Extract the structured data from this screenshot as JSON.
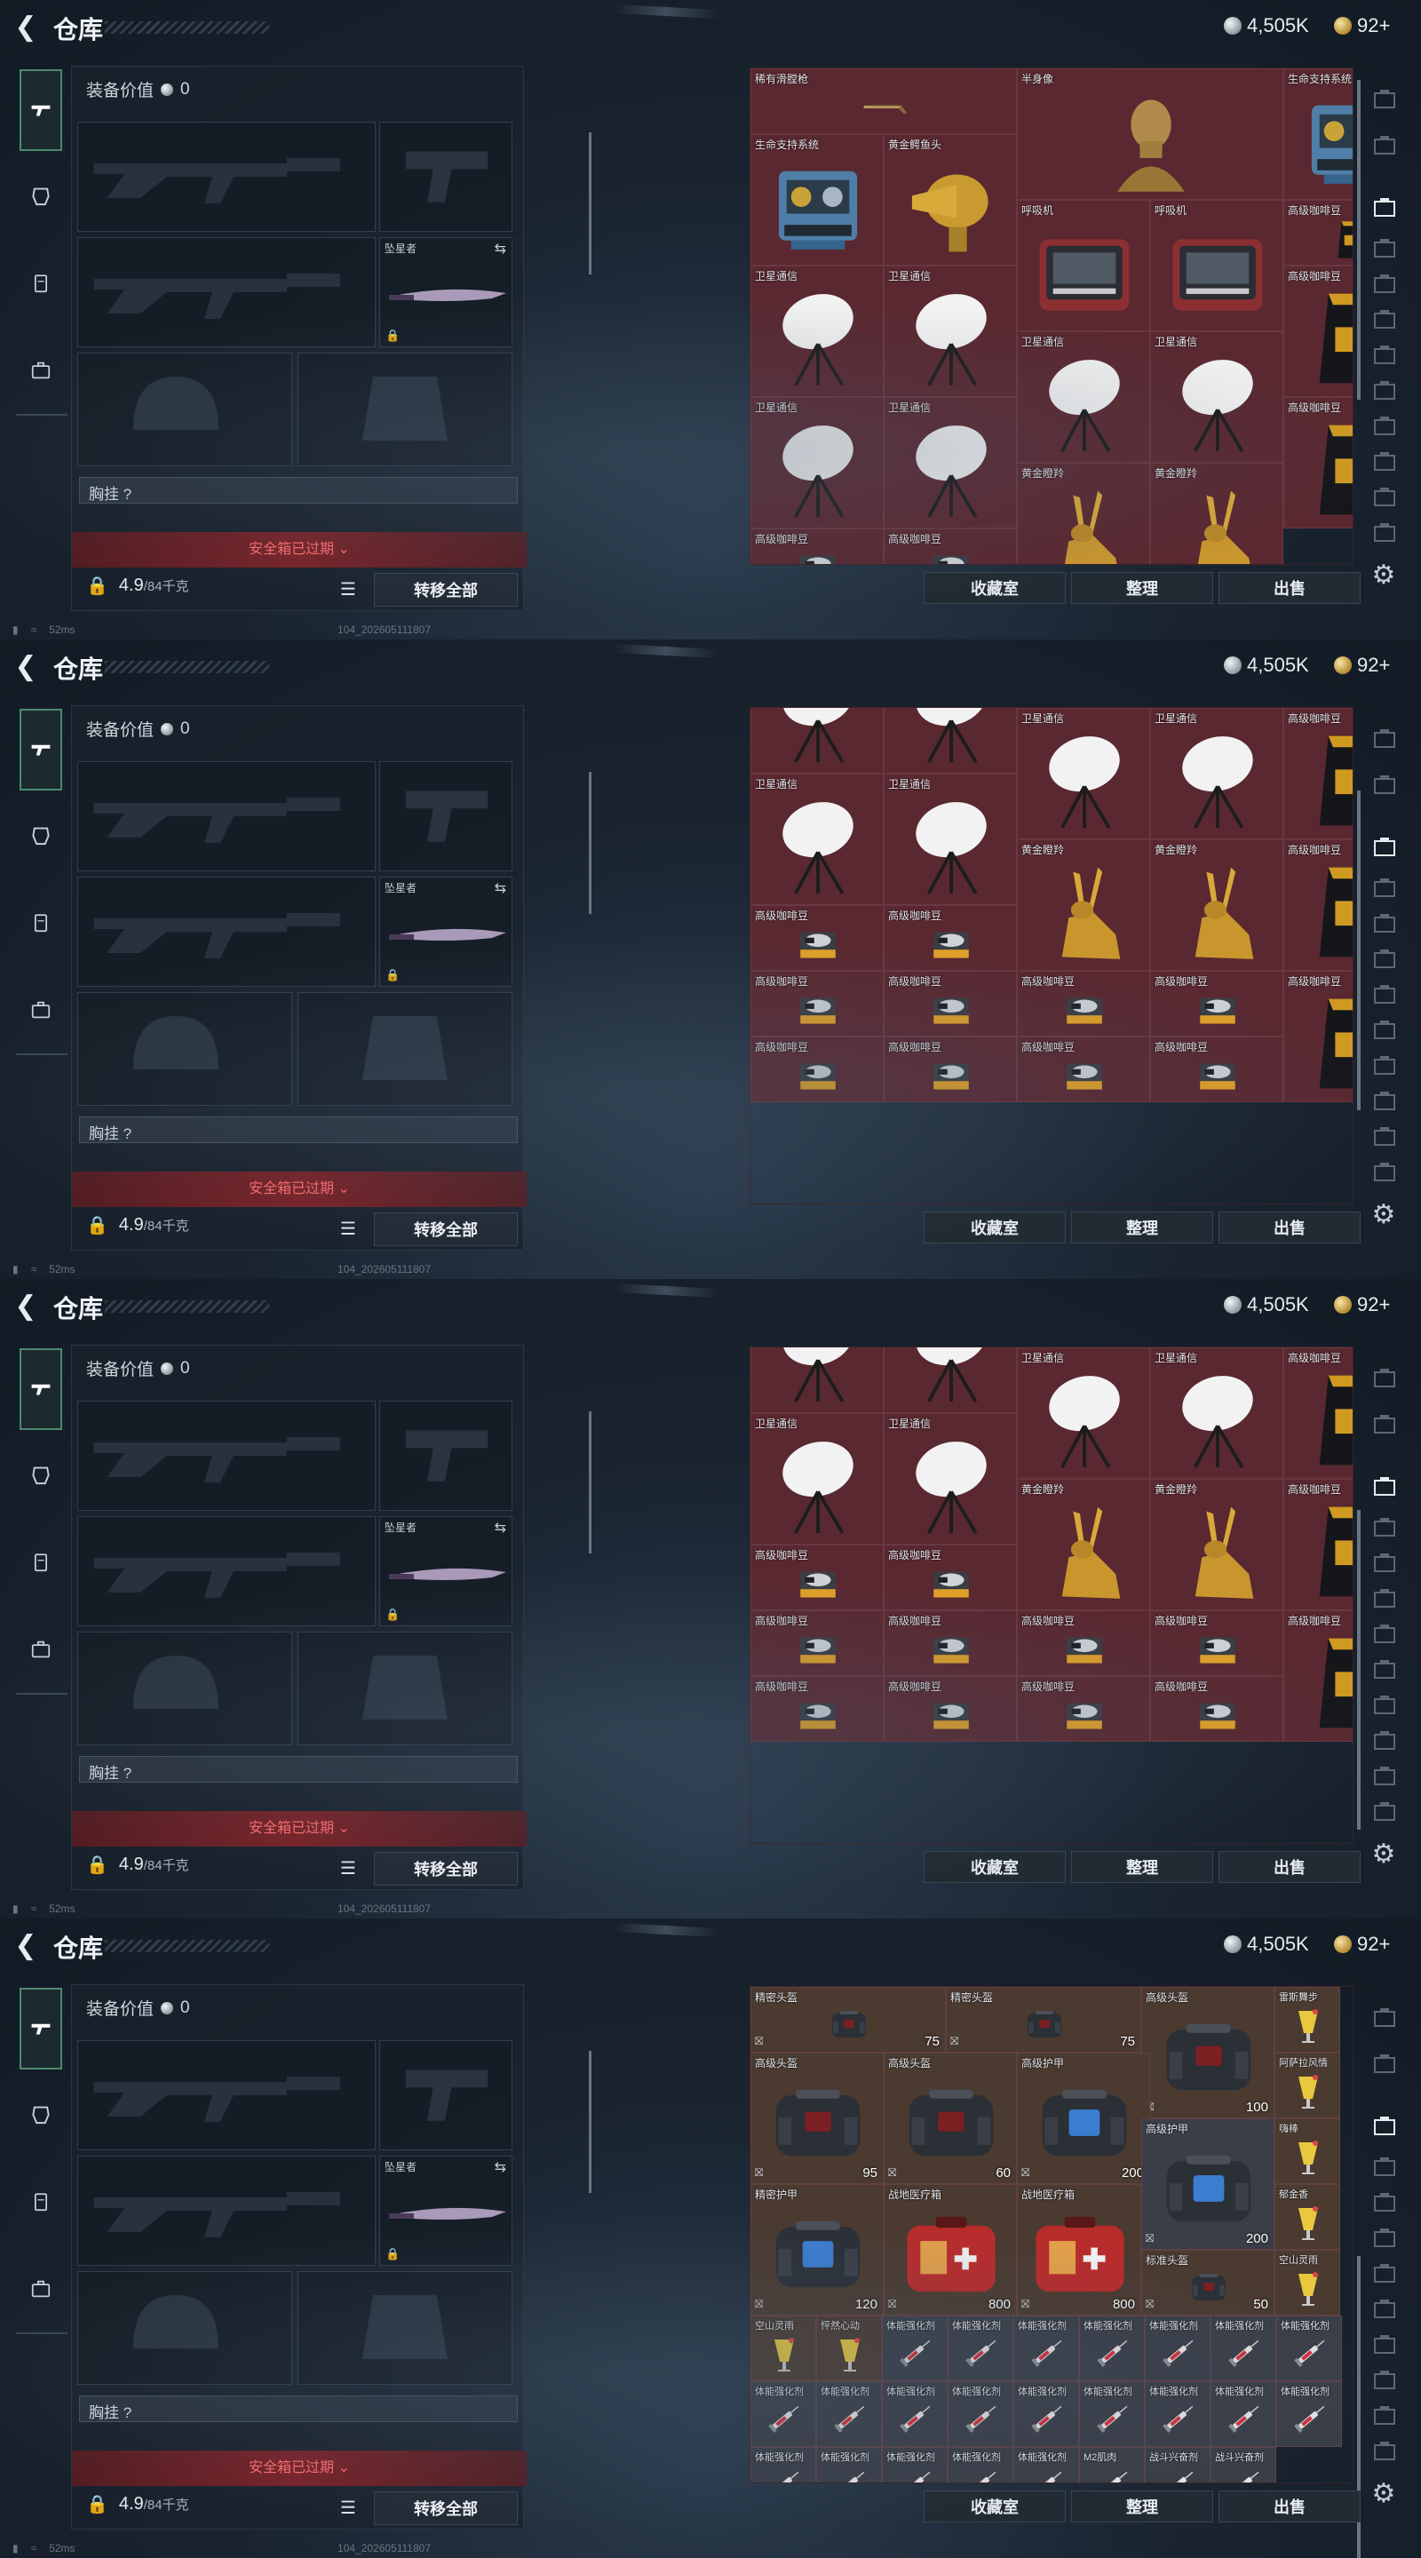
{
  "screens": [
    {
      "title": "仓库",
      "currency": {
        "silver": "4,505K",
        "gold": "92+"
      },
      "equipment": {
        "value_label": "装备价值",
        "value": "0",
        "melee_label": "坠星者",
        "chest_label": "胸挂  ?",
        "safebox_text": "安全箱已过期",
        "weight": "4.9",
        "weight_max": "/84千克",
        "transfer_label": "转移全部"
      },
      "buttons": {
        "collection": "收藏室",
        "sort": "整理",
        "sell": "出售"
      },
      "status": {
        "ping": "52ms",
        "build": "104_202605111807"
      },
      "grid_items": [
        {
          "name": "稀有滑膛枪",
          "icon": "musket-icon",
          "bg": "#5a2830"
        },
        {
          "name": "半身像",
          "icon": "bust-icon",
          "bg": "#5a2830"
        },
        {
          "name": "生命支持系统",
          "icon": "life-support-icon",
          "bg": "#5a2830"
        },
        {
          "name": "生命支持系统",
          "icon": "life-support-icon",
          "bg": "#5a2830"
        },
        {
          "name": "黄金鳄鱼头",
          "icon": "gold-croc-icon",
          "bg": "#5a2830"
        },
        {
          "name": "呼吸机",
          "icon": "ventilator-icon",
          "bg": "#5a2830"
        },
        {
          "name": "呼吸机",
          "icon": "ventilator-icon",
          "bg": "#5a2830"
        },
        {
          "name": "高级咖啡豆",
          "icon": "coffee-bag-icon",
          "bg": "#5a2830"
        },
        {
          "name": "卫星通信",
          "icon": "satellite-dish-icon",
          "bg": "#5a2830"
        },
        {
          "name": "卫星通信",
          "icon": "satellite-dish-icon",
          "bg": "#5a2830"
        },
        {
          "name": "卫星通信",
          "icon": "satellite-dish-icon",
          "bg": "#5a2830"
        },
        {
          "name": "卫星通信",
          "icon": "satellite-dish-icon",
          "bg": "#5a2830"
        },
        {
          "name": "高级咖啡豆",
          "icon": "coffee-bag-icon",
          "bg": "#5a2830"
        },
        {
          "name": "卫星通信",
          "icon": "satellite-dish-icon",
          "bg": "#5a2830"
        },
        {
          "name": "卫星通信",
          "icon": "satellite-dish-icon",
          "bg": "#5a2830"
        },
        {
          "name": "黄金瞪羚",
          "icon": "gold-gazelle-icon",
          "bg": "#5a2830"
        },
        {
          "name": "黄金瞪羚",
          "icon": "gold-gazelle-icon",
          "bg": "#5a2830"
        },
        {
          "name": "高级咖啡豆",
          "icon": "coffee-bag-icon",
          "bg": "#5a2830"
        },
        {
          "name": "高级咖啡豆",
          "icon": "coffee-tin-icon",
          "bg": "#5a2830"
        },
        {
          "name": "高级咖啡豆",
          "icon": "coffee-tin-icon",
          "bg": "#5a2830"
        }
      ]
    },
    {
      "title": "仓库",
      "currency": {
        "silver": "4,505K",
        "gold": "92+"
      },
      "equipment": {
        "value_label": "装备价值",
        "value": "0",
        "melee_label": "坠星者",
        "chest_label": "胸挂  ?",
        "safebox_text": "安全箱已过期",
        "weight": "4.9",
        "weight_max": "/84千克",
        "transfer_label": "转移全部"
      },
      "buttons": {
        "collection": "收藏室",
        "sort": "整理",
        "sell": "出售"
      },
      "status": {
        "ping": "52ms",
        "build": "104_202605111807"
      },
      "grid_items": [
        {
          "name": "",
          "icon": "satellite-dish-icon"
        },
        {
          "name": "",
          "icon": "satellite-dish-icon"
        },
        {
          "name": "",
          "icon": "ventilator-icon"
        },
        {
          "name": "",
          "icon": "ventilator-icon"
        },
        {
          "name": "",
          "icon": "coffee-bag-icon"
        },
        {
          "name": "卫星通信",
          "icon": "satellite-dish-icon"
        },
        {
          "name": "卫星通信",
          "icon": "satellite-dish-icon"
        },
        {
          "name": "卫星通信",
          "icon": "satellite-dish-icon"
        },
        {
          "name": "卫星通信",
          "icon": "satellite-dish-icon"
        },
        {
          "name": "高级咖啡豆",
          "icon": "coffee-bag-icon"
        },
        {
          "name": "黄金瞪羚",
          "icon": "gold-gazelle-icon"
        },
        {
          "name": "黄金瞪羚",
          "icon": "gold-gazelle-icon"
        },
        {
          "name": "高级咖啡豆",
          "icon": "coffee-bag-icon"
        },
        {
          "name": "高级咖啡豆",
          "icon": "coffee-tin-icon"
        },
        {
          "name": "高级咖啡豆",
          "icon": "coffee-tin-icon"
        },
        {
          "name": "高级咖啡豆",
          "icon": "coffee-tin-icon"
        },
        {
          "name": "高级咖啡豆",
          "icon": "coffee-tin-icon"
        },
        {
          "name": "高级咖啡豆",
          "icon": "coffee-tin-icon"
        },
        {
          "name": "高级咖啡豆",
          "icon": "coffee-tin-icon"
        },
        {
          "name": "高级咖啡豆",
          "icon": "coffee-bag-icon"
        },
        {
          "name": "高级咖啡豆",
          "icon": "coffee-tin-icon"
        },
        {
          "name": "高级咖啡豆",
          "icon": "coffee-tin-icon"
        },
        {
          "name": "高级咖啡豆",
          "icon": "coffee-tin-icon"
        },
        {
          "name": "高级咖啡豆",
          "icon": "coffee-tin-icon"
        }
      ]
    },
    {
      "title": "仓库",
      "currency": {
        "silver": "4,505K",
        "gold": "92+"
      },
      "equipment": {
        "value_label": "装备价值",
        "value": "0",
        "melee_label": "坠星者",
        "chest_label": "胸挂  ?",
        "safebox_text": "安全箱已过期",
        "weight": "4.9",
        "weight_max": "/84千克",
        "transfer_label": "转移全部"
      },
      "buttons": {
        "collection": "收藏室",
        "sort": "整理",
        "sell": "出售"
      },
      "status": {
        "ping": "52ms",
        "build": "104_202605111807"
      },
      "grid_items": []
    },
    {
      "title": "仓库",
      "currency": {
        "silver": "4,505K",
        "gold": "92+"
      },
      "equipment": {
        "value_label": "装备价值",
        "value": "0",
        "melee_label": "坠星者",
        "chest_label": "胸挂  ?",
        "safebox_text": "安全箱已过期",
        "weight": "4.9",
        "weight_max": "/84千克",
        "transfer_label": "转移全部"
      },
      "buttons": {
        "collection": "收藏室",
        "sort": "整理",
        "sell": "出售"
      },
      "status": {
        "ping": "52ms",
        "build": "104_202605111807"
      },
      "gear_items": [
        {
          "name": "精密头盔",
          "icon": "helmet-case-icon",
          "stat": "75"
        },
        {
          "name": "精密头盔",
          "icon": "helmet-case-icon",
          "stat": "75"
        },
        {
          "name": "高级头盔",
          "icon": "helmet-case-icon",
          "stat": "100"
        },
        {
          "name": "雷斯舞步",
          "icon": "cocktail-icon",
          "stat": ""
        },
        {
          "name": "高级头盔",
          "icon": "helmet-case-icon",
          "stat": "95"
        },
        {
          "name": "高级头盔",
          "icon": "helmet-case-icon",
          "stat": "60"
        },
        {
          "name": "高级护甲",
          "icon": "armor-case-icon",
          "stat": "200"
        },
        {
          "name": "阿萨拉风情",
          "icon": "cocktail-icon",
          "stat": ""
        },
        {
          "name": "高级护甲",
          "icon": "armor-case-icon",
          "stat": "200"
        },
        {
          "name": "嗨棒",
          "icon": "cocktail-icon",
          "stat": ""
        },
        {
          "name": "郁金香",
          "icon": "cocktail-icon",
          "stat": ""
        },
        {
          "name": "精密护甲",
          "icon": "armor-case-icon",
          "stat": "120"
        },
        {
          "name": "战地医疗箱",
          "icon": "medkit-icon",
          "stat": "800"
        },
        {
          "name": "战地医疗箱",
          "icon": "medkit-icon",
          "stat": "800"
        },
        {
          "name": "标准头盔",
          "icon": "helmet-case-icon",
          "stat": "50"
        },
        {
          "name": "空山灵雨",
          "icon": "cocktail-icon",
          "stat": ""
        },
        {
          "name": "空山灵雨",
          "icon": "cocktail-icon",
          "stat": ""
        },
        {
          "name": "怦然心动",
          "icon": "cocktail-icon",
          "stat": ""
        },
        {
          "name": "体能强化剂",
          "icon": "syringe-icon",
          "stat": ""
        },
        {
          "name": "体能强化剂",
          "icon": "syringe-icon",
          "stat": ""
        },
        {
          "name": "体能强化剂",
          "icon": "syringe-icon",
          "stat": ""
        },
        {
          "name": "体能强化剂",
          "icon": "syringe-icon",
          "stat": ""
        },
        {
          "name": "体能强化剂",
          "icon": "syringe-icon",
          "stat": ""
        },
        {
          "name": "体能强化剂",
          "icon": "syringe-icon",
          "stat": ""
        },
        {
          "name": "体能强化剂",
          "icon": "syringe-icon",
          "stat": ""
        },
        {
          "name": "体能强化剂",
          "icon": "syringe-icon",
          "stat": ""
        },
        {
          "name": "体能强化剂",
          "icon": "syringe-icon",
          "stat": ""
        },
        {
          "name": "体能强化剂",
          "icon": "syringe-icon",
          "stat": ""
        },
        {
          "name": "体能强化剂",
          "icon": "syringe-icon",
          "stat": ""
        },
        {
          "name": "体能强化剂",
          "icon": "syringe-icon",
          "stat": ""
        },
        {
          "name": "体能强化剂",
          "icon": "syringe-icon",
          "stat": ""
        },
        {
          "name": "体能强化剂",
          "icon": "syringe-icon",
          "stat": ""
        },
        {
          "name": "体能强化剂",
          "icon": "syringe-icon",
          "stat": ""
        },
        {
          "name": "体能强化剂",
          "icon": "syringe-icon",
          "stat": ""
        },
        {
          "name": "体能强化剂",
          "icon": "syringe-icon",
          "stat": ""
        },
        {
          "name": "体能强化剂",
          "icon": "syringe-icon",
          "stat": ""
        },
        {
          "name": "体能强化剂",
          "icon": "syringe-icon",
          "stat": ""
        },
        {
          "name": "体能强化剂",
          "icon": "syringe-icon",
          "stat": ""
        },
        {
          "name": "体能强化剂",
          "icon": "syringe-icon",
          "stat": ""
        },
        {
          "name": "M2肌肉",
          "icon": "syringe-icon",
          "stat": ""
        },
        {
          "name": "战斗兴奋剂",
          "icon": "syringe-icon",
          "stat": ""
        },
        {
          "name": "战斗兴奋剂",
          "icon": "syringe-icon",
          "stat": ""
        }
      ]
    }
  ],
  "colors": {
    "relic_bg": "#5a2830",
    "gear_bg_brown": "#4a3a30",
    "gear_bg_gray": "#3a3e48",
    "accent_red": "#ff6e6e"
  }
}
